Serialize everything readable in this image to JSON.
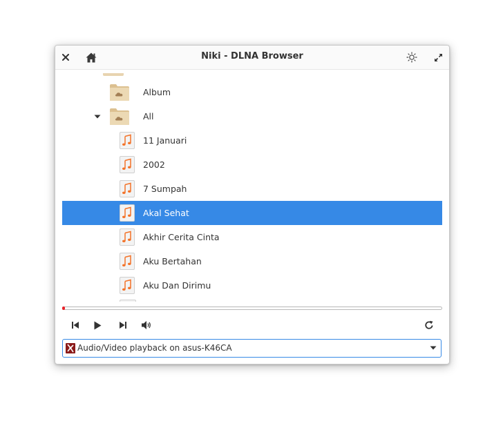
{
  "window": {
    "title": "Niki - DLNA Browser"
  },
  "titlebar": {
    "close_icon": "close-icon",
    "home_icon": "home-icon",
    "brightness_icon": "brightness-icon",
    "maximize_icon": "maximize-icon"
  },
  "tree": {
    "rows": [
      {
        "label": "Album",
        "type": "folder"
      },
      {
        "label": "All",
        "type": "folder",
        "expanded": true
      },
      {
        "label": "11 Januari",
        "type": "audio"
      },
      {
        "label": "2002",
        "type": "audio"
      },
      {
        "label": "7 Sumpah",
        "type": "audio"
      },
      {
        "label": "Akal Sehat",
        "type": "audio",
        "selected": true
      },
      {
        "label": "Akhir Cerita Cinta",
        "type": "audio"
      },
      {
        "label": "Aku Bertahan",
        "type": "audio"
      },
      {
        "label": "Aku Dan Dirimu",
        "type": "audio"
      }
    ]
  },
  "player": {
    "progress": 0.0,
    "controls": [
      "previous-icon",
      "play-icon",
      "next-icon",
      "volume-icon",
      "refresh-icon"
    ]
  },
  "renderer": {
    "selected": "Audio/Video playback on asus-K46CA"
  },
  "colors": {
    "accent": "#3689e6",
    "progress": "#e8232a",
    "folder": "#e8d4b0",
    "music_note": "#f37329"
  }
}
